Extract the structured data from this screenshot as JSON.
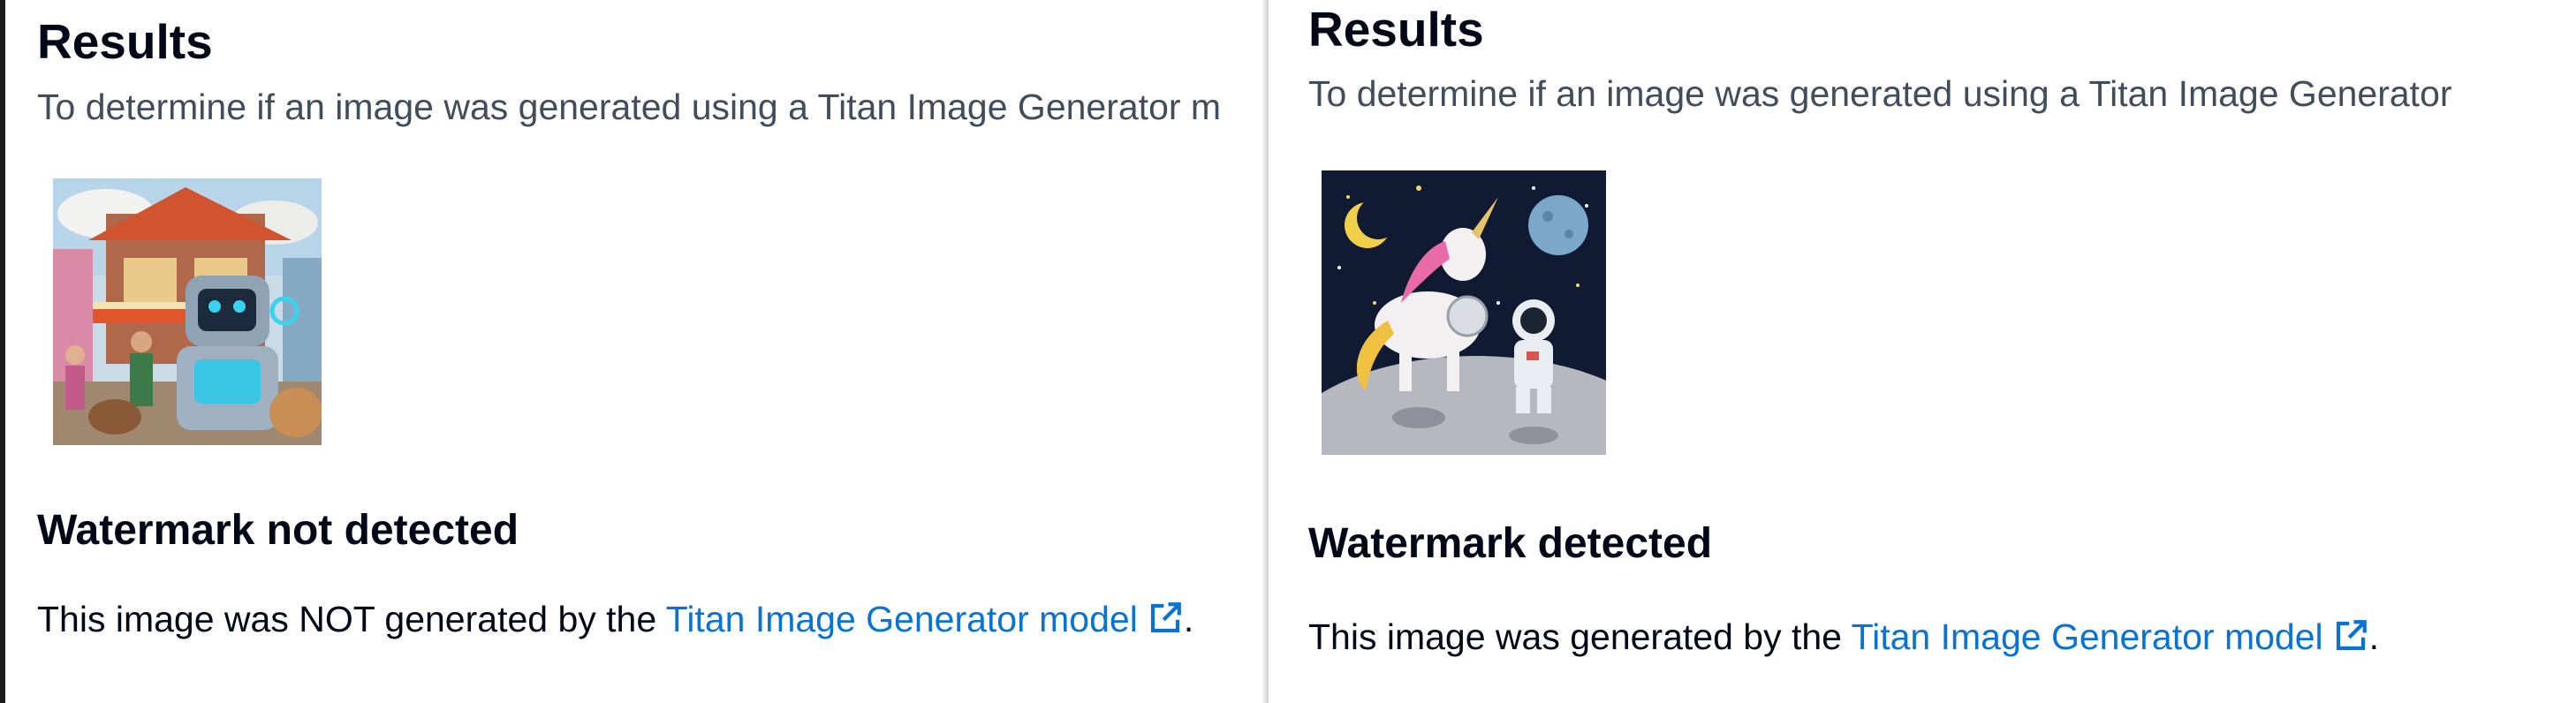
{
  "left": {
    "title": "Results",
    "description": "To determine if an image was generated using a Titan Image Generator m",
    "image_alt": "robot-market-image",
    "status_heading": "Watermark not detected",
    "verdict_prefix": "This image was NOT generated by the ",
    "link_text": "Titan Image Generator model",
    "verdict_suffix": "."
  },
  "right": {
    "title": "Results",
    "description": "To determine if an image was generated using a Titan Image Generator",
    "image_alt": "unicorn-astronaut-moon-image",
    "status_heading": "Watermark detected",
    "verdict_prefix": "This image was generated by the ",
    "link_text": "Titan Image Generator model",
    "verdict_suffix": "."
  },
  "colors": {
    "link": "#0972d3",
    "text": "#000716",
    "secondary_text": "#414d5c"
  },
  "icons": {
    "external_link": "external-link-icon"
  }
}
